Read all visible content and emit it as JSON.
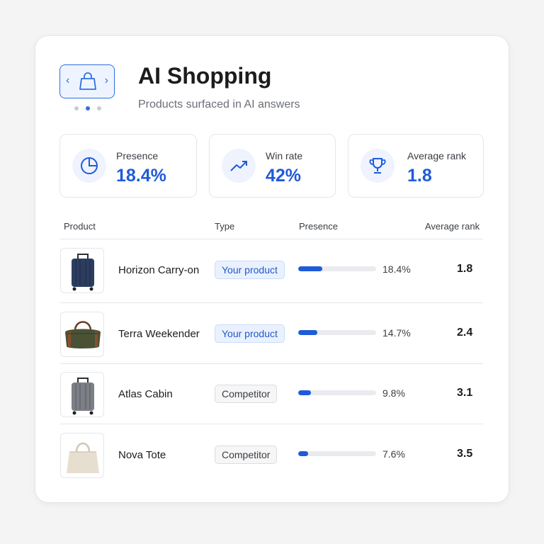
{
  "header": {
    "title": "AI Shopping",
    "subtitle": "Products surfaced in AI answers",
    "app_icon": "shopping-bag-icon",
    "carousel": {
      "dots": 3,
      "active_index": 1
    }
  },
  "stats": [
    {
      "label": "Presence",
      "value": "18.4%",
      "icon": "pie-chart-icon"
    },
    {
      "label": "Win rate",
      "value": "42%",
      "icon": "trend-up-icon"
    },
    {
      "label": "Average rank",
      "value": "1.8",
      "icon": "trophy-icon"
    }
  ],
  "table": {
    "headers": {
      "product": "Product",
      "type": "Type",
      "presence": "Presence",
      "rank": "Average rank"
    },
    "rows": [
      {
        "name": "Horizon Carry-on",
        "type": "Your product",
        "type_kind": "yours",
        "presence": "18.4%",
        "presence_value": 18.4,
        "rank": "1.8",
        "image": "navy-suitcase"
      },
      {
        "name": "Terra Weekender",
        "type": "Your product",
        "type_kind": "yours",
        "presence": "14.7%",
        "presence_value": 14.7,
        "rank": "2.4",
        "image": "olive-duffel-bag"
      },
      {
        "name": "Atlas Cabin",
        "type": "Competitor",
        "type_kind": "comp",
        "presence": "9.8%",
        "presence_value": 9.8,
        "rank": "3.1",
        "image": "gray-suitcase"
      },
      {
        "name": "Nova Tote",
        "type": "Competitor",
        "type_kind": "comp",
        "presence": "7.6%",
        "presence_value": 7.6,
        "rank": "3.5",
        "image": "cream-tote-bag"
      }
    ]
  },
  "colors": {
    "accent": "#1f5bd8",
    "accent_light": "#eef3fd",
    "bar_track": "#e9ebee"
  }
}
